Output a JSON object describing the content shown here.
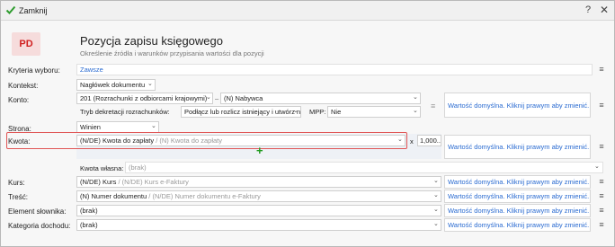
{
  "window": {
    "title": "Zamknij",
    "help": "?",
    "close": "✕"
  },
  "header": {
    "logo": "PD",
    "title": "Pozycja zapisu księgowego",
    "subtitle": "Określenie źródła i warunków przypisania wartości dla pozycji"
  },
  "rows": {
    "kryteria": {
      "label": "Kryteria wyboru:",
      "value": "Zawsze"
    },
    "kontekst": {
      "label": "Kontekst:",
      "value": "Nagłówek dokumentu"
    },
    "konto": {
      "label": "Konto:",
      "value1": "201 (Rozrachunki z odbiorcami krajowymi)",
      "separator": "–",
      "value2": "(N) Nabywca",
      "tryb_label": "Tryb dekretacji rozrachunków:",
      "tryb_value": "Podłącz lub rozlicz istniejący i utwórz nowy",
      "mpp_label": "MPP:",
      "mpp_value": "Nie"
    },
    "strona": {
      "label": "Strona:",
      "value": "Winien"
    },
    "kwota": {
      "label": "Kwota:",
      "value_main": "(N/DE) Kwota do zapłaty",
      "value_alt": "/ (N) Kwota do zapłaty",
      "multiplier_sign": "x",
      "multiplier": "1,000..."
    },
    "kwota_wlasna": {
      "label": "Kwota własna:",
      "value": "(brak)"
    },
    "kurs": {
      "label": "Kurs:",
      "value_main": "(N/DE) Kurs",
      "value_alt": "/ (N/DE) Kurs e-Faktury"
    },
    "tresc": {
      "label": "Treść:",
      "value_main": "(N) Numer dokumentu",
      "value_alt": "/ (N/DE) Numer dokumentu e-Faktury"
    },
    "element": {
      "label": "Element słownika:",
      "value": "(brak)"
    },
    "kategoria": {
      "label": "Kategoria dochodu:",
      "value": "(brak)"
    }
  },
  "default_link": "Wartość domyślna. Kliknij prawym aby zmienić.",
  "icons": {
    "check": "check-icon",
    "menu": "hamburger-menu-icon",
    "chevron": "chevron-down-icon",
    "plus": "plus-icon"
  },
  "colors": {
    "accent": "#2a6bd1",
    "highlight": "#e05555",
    "plus": "#1e9a1e",
    "logo": "#d02020"
  }
}
